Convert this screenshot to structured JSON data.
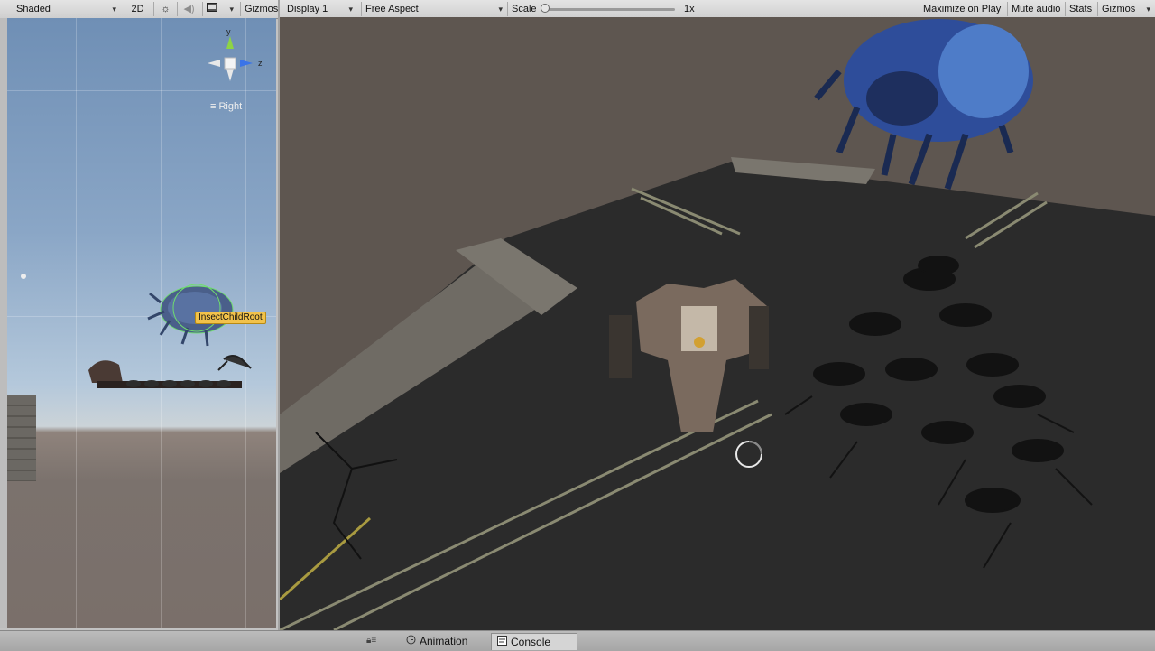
{
  "scene_toolbar": {
    "shading_mode": "Shaded",
    "mode_2d": "2D",
    "light_icon": "sun-icon",
    "audio_icon": "speaker-icon",
    "effects_icon": "image-icon",
    "gizmos_label": "Gizmos"
  },
  "scene_view": {
    "gizmo": {
      "y_label": "y",
      "z_label": "z"
    },
    "view_label": "Right",
    "selected_object": "InsectChildRoot"
  },
  "game_toolbar": {
    "display": "Display 1",
    "aspect": "Free Aspect",
    "scale_label": "Scale",
    "scale_value": "1x",
    "scale_fraction": 0.0,
    "maximize_on_play": "Maximize on Play",
    "mute_audio": "Mute audio",
    "stats": "Stats",
    "gizmos": "Gizmos"
  },
  "bottom_tabs": [
    {
      "label": "Animation",
      "icon": "clock-icon",
      "active": false
    },
    {
      "label": "Console",
      "icon": "console-icon",
      "active": true
    }
  ],
  "colors": {
    "selection_label": "#f2c24a",
    "gizmo_y": "#8ed445",
    "gizmo_z": "#3a74e8",
    "road": "#2b2b2b",
    "road_line": "#8a8a72"
  }
}
